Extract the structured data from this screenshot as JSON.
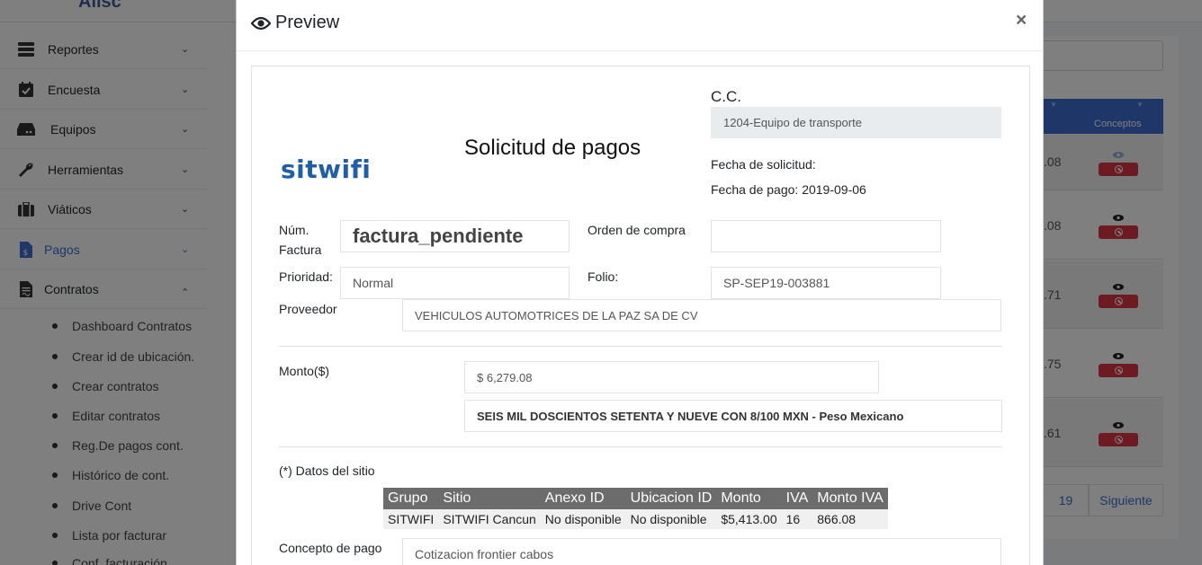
{
  "app": {
    "logo_fragment": "Alisc"
  },
  "sidebar": {
    "items": [
      {
        "label": "Reportes",
        "icon": "server-icon"
      },
      {
        "label": "Encuesta",
        "icon": "calendar-check-icon"
      },
      {
        "label": "Equipos",
        "icon": "hdd-icon"
      },
      {
        "label": "Herramientas",
        "icon": "wrench-icon"
      },
      {
        "label": "Viáticos",
        "icon": "suitcase-icon"
      },
      {
        "label": "Pagos",
        "icon": "file-invoice-dollar-icon",
        "active": true
      },
      {
        "label": "Contratos",
        "icon": "file-contract-icon",
        "expanded": true
      }
    ],
    "subitems": [
      "Dashboard Contratos",
      "Crear id de ubicación.",
      "Crear contratos",
      "Editar contratos",
      "Reg.De pagos cont.",
      "Histórico de cont.",
      "Drive Cont",
      "Lista por facturar",
      "Conf. facturación"
    ]
  },
  "background_table": {
    "header": "Conceptos",
    "amounts": [
      ".08",
      ".08",
      ".71",
      ".75",
      ".61"
    ],
    "pager": {
      "page": "19",
      "next": "Siguiente"
    }
  },
  "modal": {
    "title": "Preview",
    "close": "×",
    "brand": "sitwifi",
    "doc_title": "Solicitud de pagos",
    "cc_label": "C.C.",
    "cc_value": "1204-Equipo de transporte",
    "fecha_solicitud_label": "Fecha de solicitud:",
    "fecha_pago_label": "Fecha de pago:",
    "fecha_pago_value": "2019-09-06",
    "num_factura_label": "Núm. Factura",
    "num_factura_value": "factura_pendiente",
    "orden_compra_label": "Orden de compra",
    "orden_compra_value": "",
    "prioridad_label": "Prioridad:",
    "prioridad_value": "Normal",
    "folio_label": "Folio:",
    "folio_value": "SP-SEP19-003881",
    "proveedor_label": "Proveedor",
    "proveedor_value": "VEHICULOS AUTOMOTRICES DE LA PAZ SA DE CV",
    "monto_label": "Monto($)",
    "monto_value": "$ 6,279.08",
    "monto_letra": "SEIS MIL DOSCIENTOS SETENTA Y NUEVE  CON 8/100 MXN - Peso Mexicano",
    "datos_sitio_label": "(*) Datos del sitio",
    "sitio_table": {
      "headers": [
        "Grupo",
        "Sitio",
        "Anexo ID",
        "Ubicacion ID",
        "Monto",
        "IVA",
        "Monto IVA"
      ],
      "rows": [
        [
          "SITWIFI",
          "SITWIFI Cancun",
          "No disponible",
          "No disponible",
          "$5,413.00",
          "16",
          "866.08"
        ]
      ]
    },
    "concepto_label": "Concepto de pago",
    "concepto_value": "Cotizacion frontier cabos"
  },
  "colors": {
    "accent": "#3c6fd1",
    "brand": "#1f5ea8",
    "danger": "#dc3545",
    "table_header": "#6c6c6c"
  }
}
